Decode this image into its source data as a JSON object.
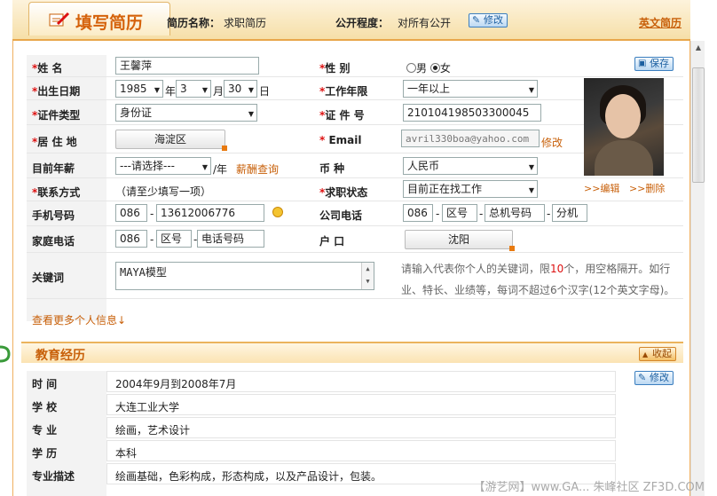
{
  "header": {
    "title": "填写简历",
    "resume_name_label": "简历名称：",
    "resume_name": "求职简历",
    "visibility_label": "公开程度：",
    "visibility": "对所有公开",
    "edit_label": "修改",
    "english_resume": "英文简历"
  },
  "form": {
    "save_label": "保存",
    "name_label": "姓    名",
    "name_value": "王馨萍",
    "gender_label": "性    别",
    "gender_male": "男",
    "gender_female": "女",
    "gender_selected": "女",
    "birth_label": "出生日期",
    "birth_year": "1985",
    "birth_year_unit": "年",
    "birth_month": "3",
    "birth_month_unit": "月",
    "birth_day": "30",
    "birth_day_unit": "日",
    "work_years_label": "工作年限",
    "work_years": "一年以上",
    "id_type_label": "证件类型",
    "id_type": "身份证",
    "id_no_label": "证 件 号",
    "id_no": "210104198503300045",
    "residence_label": "居 住 地",
    "residence": "海淀区",
    "email_label": "Email",
    "email": "avril330boa@yahoo.com",
    "email_edit": "修改",
    "salary_label": "目前年薪",
    "salary": "---请选择---",
    "salary_unit": "/年",
    "salary_query": "薪酬查询",
    "currency_label": "币    种",
    "currency": "人民币",
    "contact_label": "联系方式",
    "contact_hint": "（请至少填写一项）",
    "job_status_label": "求职状态",
    "job_status": "目前正在找工作",
    "mobile_label": "手机号码",
    "mobile_prefix": "086",
    "mobile": "13612006776",
    "company_phone_label": "公司电话",
    "company_phone_country": "086",
    "company_phone_area": "区号",
    "company_phone_main": "总机号码",
    "company_phone_ext": "分机",
    "home_phone_label": "家庭电话",
    "home_phone_country": "086",
    "home_phone_area": "区号",
    "home_phone_number": "电话号码",
    "hukou_label": "户    口",
    "hukou": "沈阳",
    "keywords_label": "关键词",
    "keywords": "MAYA模型",
    "keywords_hint_1": "请输入代表你个人的关键词，限",
    "keywords_hint_limit": "10",
    "keywords_hint_2": "个，用空格隔开。如行",
    "keywords_hint_3": "业、特长、业绩等，每词不超过6个汉字(12个英文字母)。",
    "more_info": "查看更多个人信息↓",
    "photo_edit": ">>编辑",
    "photo_delete": ">>删除"
  },
  "education": {
    "title": "教育经历",
    "collapse_label": "收起",
    "edit_label": "修改",
    "rows": [
      {
        "label": "时    间",
        "value": "2004年9月到2008年7月"
      },
      {
        "label": "学    校",
        "value": "大连工业大学"
      },
      {
        "label": "专    业",
        "value": "绘画，艺术设计"
      },
      {
        "label": "学    历",
        "value": "本科"
      },
      {
        "label": "专业描述",
        "value": "绘画基础，色彩构成，形态构成，以及产品设计，包装。"
      }
    ]
  },
  "watermark": "【游艺网】www.GA... 朱峰社区 ZF3D.COM"
}
